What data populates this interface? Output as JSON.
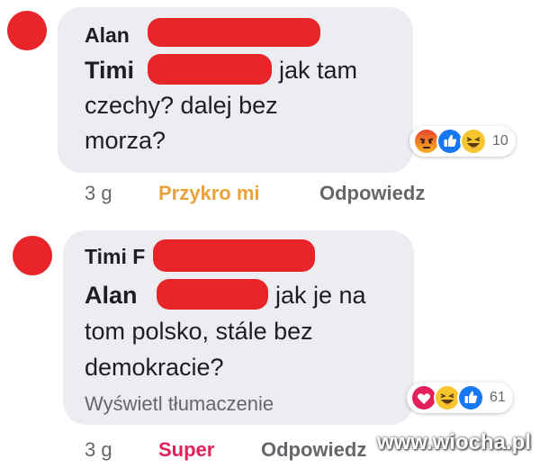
{
  "comments": [
    {
      "author_first": "Alan",
      "mention_first": "Timi",
      "lines": [
        "jak tam",
        "czechy? dalej bez",
        "morza?"
      ],
      "reaction_icons": [
        "angry-icon",
        "like-icon",
        "haha-icon"
      ],
      "reaction_count": "10",
      "time": "3 g",
      "my_reaction": "Przykro mi",
      "reply": "Odpowiedz"
    },
    {
      "author_first": "Timi F",
      "mention_first": "Alan",
      "lines": [
        "jak je na",
        "tom polsko, stále bez",
        "demokracie?"
      ],
      "translate": "Wyświetl tłumaczenie",
      "reaction_icons": [
        "love-icon",
        "haha-icon",
        "like-icon"
      ],
      "reaction_count": "61",
      "time": "3 g",
      "my_reaction": "Super",
      "reply": "Odpowiedz"
    }
  ],
  "watermark": "www.wiocha.pl",
  "colors": {
    "bubble": "#ebedf1",
    "redaction": "#e8262a",
    "reaction_sad": "#e9a23b",
    "reaction_love": "#e2215b",
    "like_blue": "#1877f2"
  }
}
